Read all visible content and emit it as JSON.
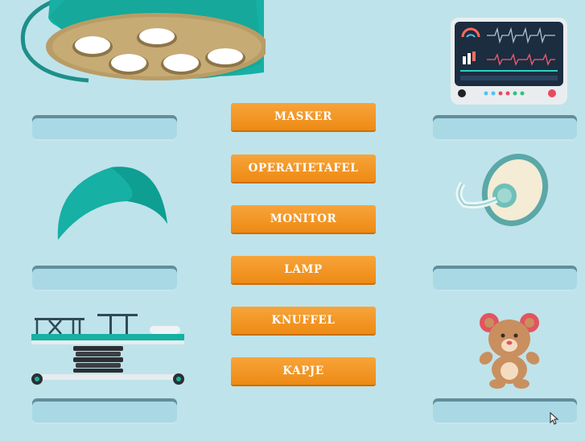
{
  "game": {
    "words": [
      "MASKER",
      "OPERATIETAFEL",
      "MONITOR",
      "LAMP",
      "KNUFFEL",
      "KAPJE"
    ]
  },
  "pictures": {
    "left": [
      "surgical-lamp-icon",
      "surgical-cap-icon",
      "operating-table-icon"
    ],
    "right": [
      "patient-monitor-icon",
      "anesthesia-mask-icon",
      "teddy-bear-icon"
    ]
  },
  "colors": {
    "background": "#bfe3ea",
    "tile": "#f29420",
    "teal": "#1ab3a6",
    "slot": "#a9d9e5"
  }
}
